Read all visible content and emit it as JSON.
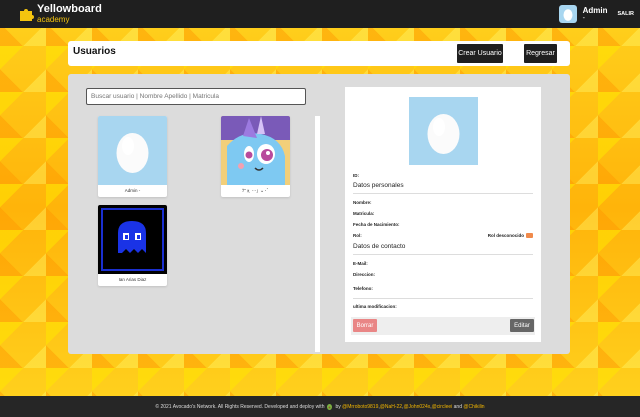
{
  "brand": {
    "name": "Yellowboard",
    "sub": "academy"
  },
  "user": {
    "name": "Admin",
    "role": "-",
    "logout": "SALIR"
  },
  "header": {
    "title": "Usuarios",
    "create_label": "Crear Usuario",
    "back_label": "Regresar"
  },
  "search": {
    "placeholder": "Buscar usuario | Nombre Apellido | Matricula"
  },
  "users": [
    {
      "name": "Admin -",
      "avatar": "egg-avatar"
    },
    {
      "name": "ﾂ''ぇ ･･」ᴗ ･ﾞ",
      "avatar": "trixie-avatar"
    },
    {
      "name": "Ian Arias Diaz",
      "avatar": "pacman-ghost-avatar"
    }
  ],
  "detail": {
    "id_label": "ID:",
    "personal_title": "Datos personales",
    "nombre_label": "Nombre:",
    "matricula_label": "Matricula:",
    "fecha_label": "Fecha de Nacimiento:",
    "rol_label": "Rol:",
    "rol_value": "Rol desconocido",
    "contact_title": "Datos de contacto",
    "email_label": "E-Mail:",
    "direccion_label": "Direccion:",
    "telefono_label": "Telefono:",
    "modificacion_label": "ultima modificacion:",
    "delete_label": "Borrar",
    "edit_label": "Editar"
  },
  "footer": {
    "text": "© 2021 Avocado's Network. All Rights Reserved. Developed and deploy with",
    "by": "by",
    "authors": [
      "@Mrroboto9819",
      "@NaH-22",
      "@John024x",
      "@circleei"
    ],
    "and": "and",
    "last_author": "@Chikilin"
  },
  "colors": {
    "accent": "#f2b600",
    "navbar": "#1f1f1f",
    "delete": "#e98686",
    "edit": "#666666"
  }
}
